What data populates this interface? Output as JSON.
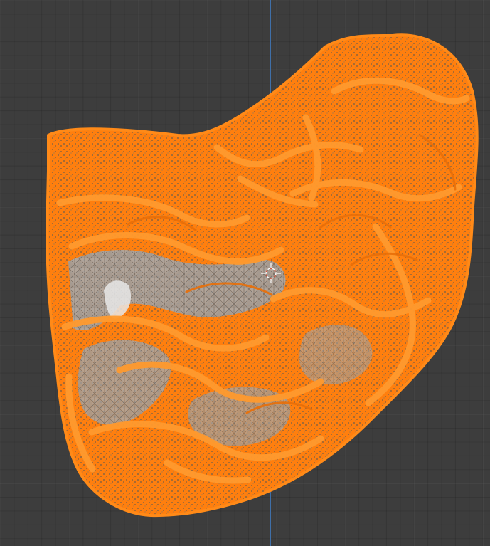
{
  "viewport": {
    "name": "3D Viewport",
    "grid_color": "#3d3d3d",
    "axis_x_color": "#a9414a",
    "axis_z_color": "#3f6fa8"
  },
  "mesh": {
    "name": "selected-brain-mesh",
    "selected": true,
    "selection_color": "#ff7f0e",
    "face_color": "#9a9a9a",
    "display_mode": "wireframe-overlay"
  },
  "cursor": {
    "name": "3d-cursor",
    "icon": "crosshair-icon",
    "colors": [
      "#ffffff",
      "#d9412b"
    ]
  }
}
